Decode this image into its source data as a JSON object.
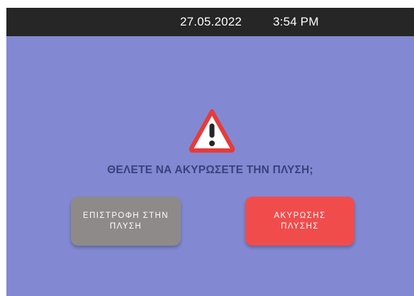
{
  "status_bar": {
    "date": "27.05.2022",
    "time": "3:54 PM"
  },
  "dialog": {
    "icon": "warning-triangle-icon",
    "question": "ΘΕΛΕΤΕ ΝΑ ΑΚΥΡΩΣΕΤΕ ΤΗΝ ΠΛΥΣΗ;",
    "return_button_label": "ΕΠΙΣΤΡΟΦΗ ΣΤΗΝ ΠΛΥΣΗ",
    "cancel_button_label": "ΑΚΥΡΩΣΗΣ ΠΛΥΣΗΣ"
  },
  "colors": {
    "background": "#8289d2",
    "status_bar": "#262626",
    "question_text": "#39427a",
    "return_button": "#8e8a89",
    "cancel_button": "#f14c4c",
    "warning_red": "#e63b3b"
  }
}
